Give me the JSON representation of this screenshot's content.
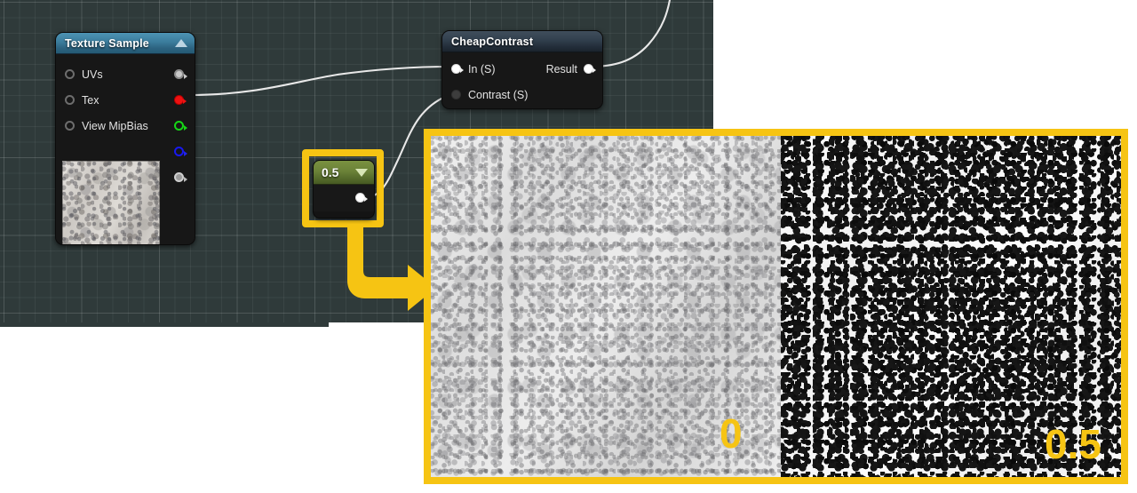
{
  "graph": {
    "background_color": "#2f3a3a",
    "grid_line_color": "#3c4747"
  },
  "nodes": {
    "texture_sample": {
      "title": "Texture Sample",
      "header_color": "#3b7c9c",
      "collapse_icon": "triangle-up-icon",
      "inputs": [
        {
          "label": "UVs",
          "pin": "hollow-circle-icon"
        },
        {
          "label": "Tex",
          "pin": "hollow-circle-icon"
        },
        {
          "label": "View MipBias",
          "pin": "hollow-circle-icon"
        }
      ],
      "outputs": [
        {
          "label": "",
          "pin": "rgb-pin-icon",
          "color": "#c9c9c9"
        },
        {
          "label": "",
          "pin": "red-channel-pin-icon",
          "color": "#ee1111"
        },
        {
          "label": "",
          "pin": "green-channel-pin-icon",
          "color": "#16d616"
        },
        {
          "label": "",
          "pin": "blue-channel-pin-icon",
          "color": "#1818ef"
        },
        {
          "label": "",
          "pin": "alpha-channel-pin-icon",
          "color": "#9a9a9a"
        }
      ],
      "thumbnail": "concrete-texture-thumbnail"
    },
    "cheap_contrast": {
      "title": "CheapContrast",
      "header_color": "#33414f",
      "inputs": [
        {
          "label": "In (S)",
          "pin": "connected-pin-icon",
          "color": "#ffffff"
        },
        {
          "label": "Contrast (S)",
          "pin": "unconnected-pin-icon",
          "color": "#3d3d3d"
        }
      ],
      "outputs": [
        {
          "label": "Result",
          "pin": "connected-pin-icon",
          "color": "#ffffff"
        }
      ]
    },
    "constant": {
      "value": "0.5",
      "header_color": "#6b8238",
      "dropdown_icon": "caret-down-icon",
      "output_pin": "connected-pin-icon",
      "highlight_color": "#f6c413"
    }
  },
  "annotations": {
    "arrow": "elbow-arrow-down-right",
    "arrow_color": "#f6c413"
  },
  "preview": {
    "border_color": "#f6c413",
    "left_label": "0",
    "right_label": "0.5",
    "left_description": "low-contrast-preview",
    "right_description": "high-contrast-preview"
  }
}
